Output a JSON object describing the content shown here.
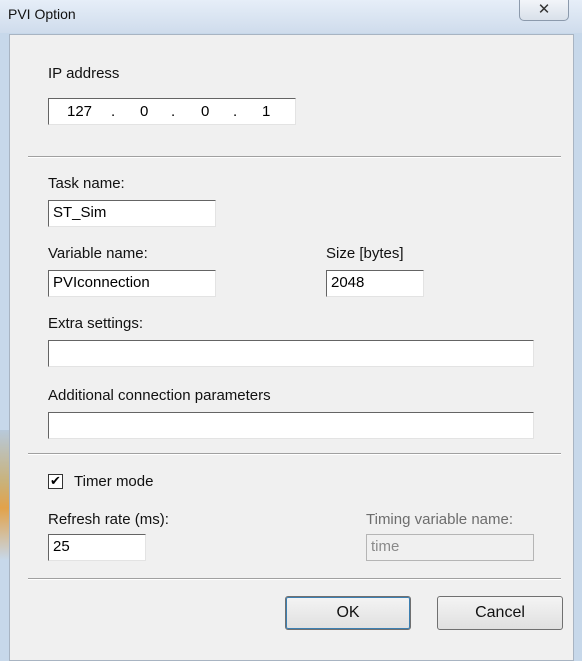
{
  "window": {
    "title": "PVI Option",
    "close_glyph": "✕"
  },
  "ip": {
    "label": "IP address",
    "octets": [
      "127",
      "0",
      "0",
      "1"
    ],
    "dot": "."
  },
  "task": {
    "label": "Task name:",
    "value": "ST_Sim"
  },
  "variable": {
    "label": "Variable name:",
    "value": "PVIconnection"
  },
  "size": {
    "label": "Size [bytes]",
    "value": "2048"
  },
  "extra": {
    "label": "Extra settings:",
    "value": ""
  },
  "additional": {
    "label": "Additional connection parameters",
    "value": ""
  },
  "timer": {
    "label": "Timer mode",
    "checked": true,
    "check_glyph": "✔"
  },
  "refresh": {
    "label": "Refresh rate (ms):",
    "value": "25"
  },
  "timing_var": {
    "label": "Timing variable name:",
    "value": "time",
    "disabled": true
  },
  "buttons": {
    "ok": "OK",
    "cancel": "Cancel"
  },
  "colors": {
    "frame": "#c7d8ea",
    "client_bg": "#f0f0f0",
    "disabled_text": "#6d6d6d"
  }
}
